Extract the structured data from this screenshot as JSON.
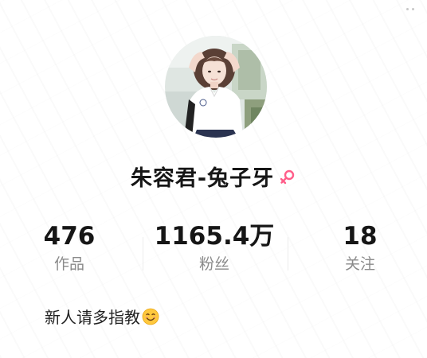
{
  "profile": {
    "nickname": "朱容君-兔子牙",
    "gender_icon": "female-gender-icon",
    "gender_color": "#ff5e8a",
    "bio": "新人请多指教",
    "bio_emoji": "smiling-face-emoji-icon"
  },
  "stats": [
    {
      "value": "476",
      "label": "作品"
    },
    {
      "value": "1165.4万",
      "label": "粉丝"
    },
    {
      "value": "18",
      "label": "关注"
    }
  ],
  "colors": {
    "text_primary": "#161616",
    "text_secondary": "#8a8a8a",
    "divider": "#ececec"
  }
}
